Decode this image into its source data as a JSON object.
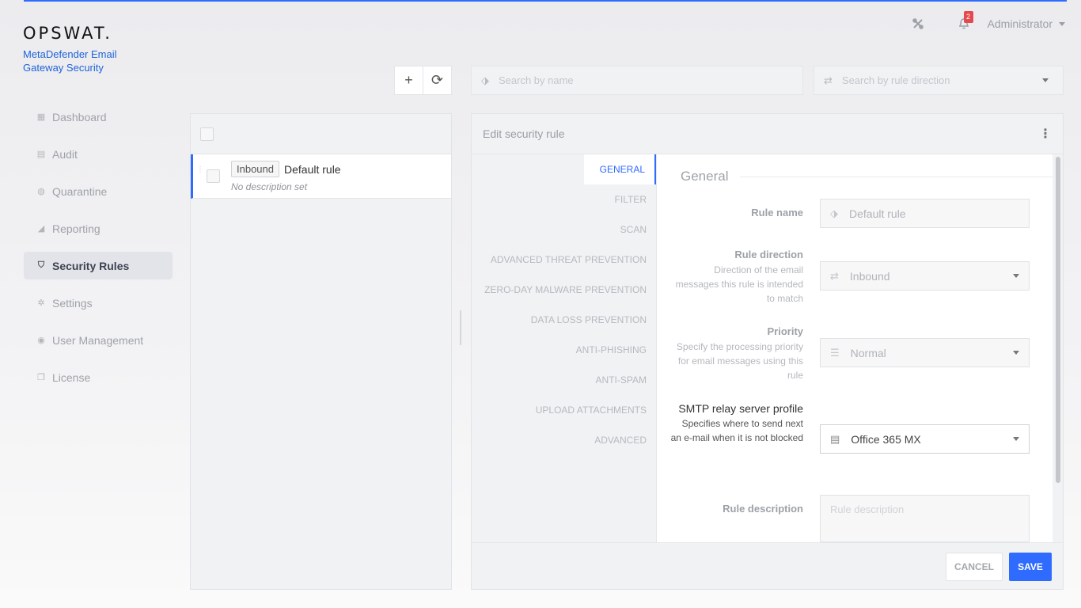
{
  "brand": {
    "logo": "OPSWAT.",
    "product": "MetaDefender Email Gateway Security"
  },
  "topbar": {
    "user": "Administrator",
    "notification_count": "2"
  },
  "sidebar": {
    "items": [
      {
        "label": "Dashboard",
        "icon": "dashboard-icon"
      },
      {
        "label": "Audit",
        "icon": "document-icon"
      },
      {
        "label": "Quarantine",
        "icon": "quarantine-icon"
      },
      {
        "label": "Reporting",
        "icon": "chart-icon"
      },
      {
        "label": "Security Rules",
        "icon": "shield-icon",
        "active": true
      },
      {
        "label": "Settings",
        "icon": "gear-icon"
      },
      {
        "label": "User Management",
        "icon": "user-icon"
      },
      {
        "label": "License",
        "icon": "license-icon"
      }
    ]
  },
  "toolbar": {
    "add": "+",
    "refresh": "⟳",
    "search_name_placeholder": "Search by name",
    "search_direction_placeholder": "Search by rule direction"
  },
  "rules": {
    "items": [
      {
        "direction": "Inbound",
        "name": "Default rule",
        "description": "No description set"
      }
    ]
  },
  "editor": {
    "title": "Edit security rule",
    "tabs": [
      "GENERAL",
      "FILTER",
      "SCAN",
      "ADVANCED THREAT PREVENTION",
      "ZERO-DAY MALWARE PREVENTION",
      "DATA LOSS PREVENTION",
      "ANTI-PHISHING",
      "ANTI-SPAM",
      "UPLOAD ATTACHMENTS",
      "ADVANCED"
    ],
    "section": "General",
    "fields": {
      "rule_name": {
        "label": "Rule name",
        "value": "Default rule"
      },
      "rule_direction": {
        "label": "Rule direction",
        "help": "Direction of the email messages this rule is intended to match",
        "value": "Inbound"
      },
      "priority": {
        "label": "Priority",
        "help": "Specify the processing priority for email messages using this rule",
        "value": "Normal"
      },
      "smtp": {
        "label": "SMTP relay server profile",
        "help": "Specifies where to send next an e-mail when it is not blocked",
        "value": "Office 365 MX"
      },
      "description": {
        "label": "Rule description",
        "placeholder": "Rule description"
      }
    },
    "cancel": "CANCEL",
    "save": "SAVE"
  },
  "colors": {
    "accent": "#2f6bff",
    "brand_text": "#1e63d8",
    "badge": "#e5484d"
  }
}
